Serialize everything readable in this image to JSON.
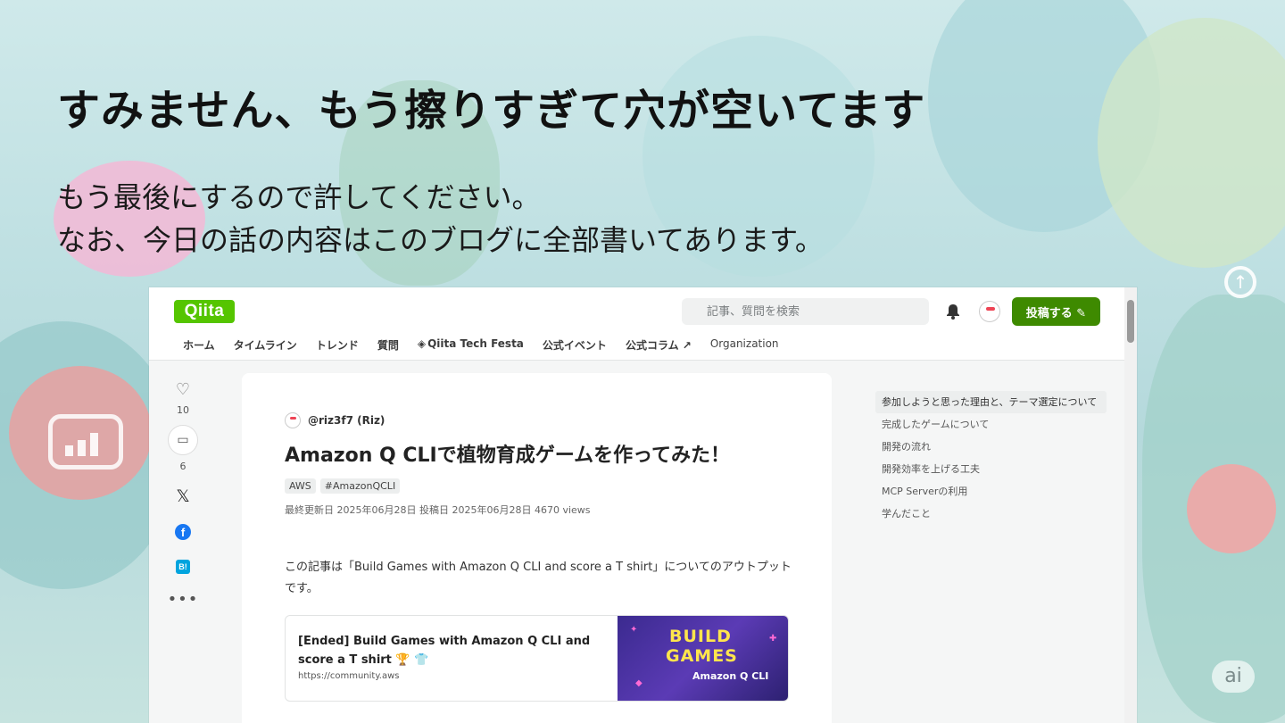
{
  "slide": {
    "title": "すみません、もう擦りすぎて穴が空いてます",
    "subtitle_line1": "もう最後にするので許してください。",
    "subtitle_line2": "なお、今日の話の内容はこのブログに全部書いてあります。"
  },
  "qiita": {
    "logo": "Qiita",
    "search_placeholder": "記事、質問を検索",
    "post_button": "投稿する ✎",
    "nav": [
      "ホーム",
      "タイムライン",
      "トレンド",
      "質問",
      "Qiita Tech Festa",
      "公式イベント",
      "公式コラム ↗",
      "Organization"
    ],
    "actions": {
      "likes": "10",
      "stocks": "6"
    },
    "article": {
      "author": "@riz3f7 (Riz)",
      "title": "Amazon Q CLIで植物育成ゲームを作ってみた！",
      "tags": [
        "AWS",
        "#AmazonQCLI"
      ],
      "meta": "最終更新日 2025年06月28日  投稿日 2025年06月28日  4670 views",
      "body": "この記事は「Build Games with Amazon Q CLI and score a T shirt」についてのアウトプットです。",
      "link_card": {
        "title": "[Ended] Build Games with Amazon Q CLI and score a T shirt 🏆 👕",
        "url": "https://community.aws",
        "image_text1": "BUILD",
        "image_text2": "GAMES",
        "image_text3": "Amazon Q CLI"
      }
    },
    "toc": [
      "参加しようと思った理由と、テーマ選定について",
      "完成したゲームについて",
      "開発の流れ",
      "開発効率を上げる工夫",
      "MCP Serverの利用",
      "学んだこと"
    ]
  },
  "badge": "ai",
  "colors": {
    "qiita_green": "#55c500",
    "post_button": "#3e8a00",
    "facebook": "#1877f2",
    "hatena": "#00a4de"
  }
}
